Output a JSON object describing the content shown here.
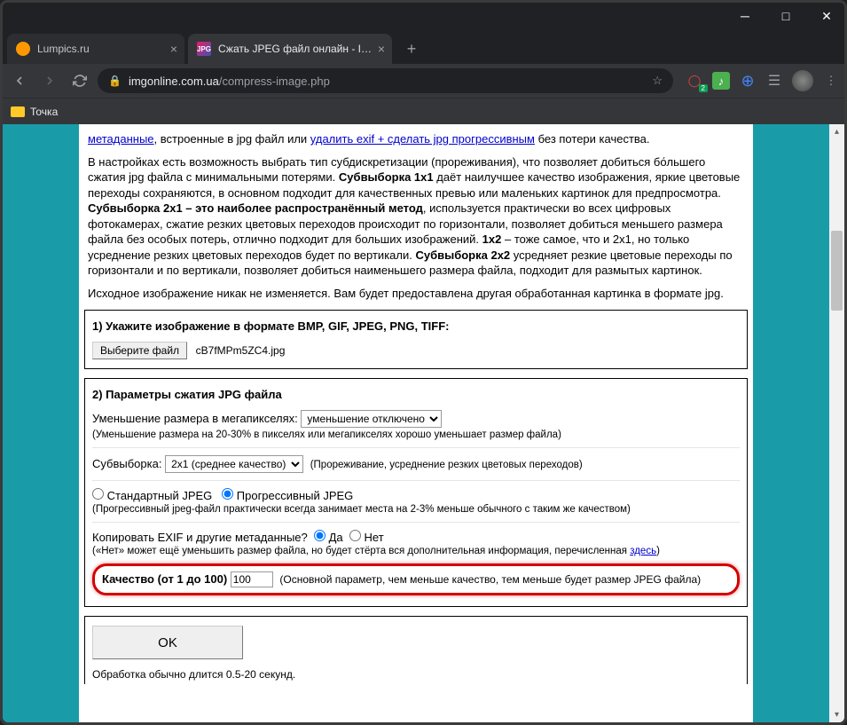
{
  "window": {
    "tabs": [
      {
        "title": "Lumpics.ru",
        "active": false
      },
      {
        "title": "Сжать JPEG файл онлайн - IMG",
        "active": true
      }
    ],
    "url_host": "imgonline.com.ua",
    "url_path": "/compress-image.php",
    "bookmark": "Точка"
  },
  "intro": {
    "line1_pre": "метаданные",
    "line1_mid": ", встроенные в jpg файл или ",
    "line1_link": "удалить exif + сделать jpg прогрессивным",
    "line1_post": " без потери качества.",
    "p2": "В настройках есть возможность выбрать тип субдискретизации (прореживания), что позволяет добиться бо́льшего сжатия jpg файла с минимальными потерями. Субвыборка 1x1 даёт наилучшее качество изображения, яркие цветовые переходы сохраняются, в основном подходит для качественных превью или маленьких картинок для предпросмотра. Субвыборка 2x1 – это наиболее распространённый метод, используется практически во всех цифровых фотокамерах, сжатие резких цветовых переходов происходит по горизонтали, позволяет добиться меньшего размера файла без особых потерь, отлично подходит для больших изображений. 1x2 – тоже самое, что и 2x1, но только усреднение резких цветовых переходов будет по вертикали. Субвыборка 2x2 усредняет резкие цветовые переходы по горизонтали и по вертикали, позволяет добиться наименьшего размера файла, подходит для размытых картинок.",
    "p3": "Исходное изображение никак не изменяется. Вам будет предоставлена другая обработанная картинка в формате jpg."
  },
  "step1": {
    "title": "1) Укажите изображение в формате BMP, GIF, JPEG, PNG, TIFF:",
    "button": "Выберите файл",
    "filename": "cB7fMPm5ZC4.jpg"
  },
  "step2": {
    "title": "2) Параметры сжатия JPG файла",
    "megapx_label": "Уменьшение размера в мегапикселях:",
    "megapx_value": "уменьшение отключено",
    "megapx_hint": "(Уменьшение размера на 20-30% в пикселях или мегапикселях хорошо уменьшает размер файла)",
    "subsample_label": "Субвыборка:",
    "subsample_value": "2x1 (среднее качество)",
    "subsample_hint": "(Прореживание, усреднение резких цветовых переходов)",
    "standard_label": "Стандартный JPEG",
    "progressive_label": "Прогрессивный JPEG",
    "progressive_hint": "(Прогрессивный jpeg-файл практически всегда занимает места на 2-3% меньше обычного с таким же качеством)",
    "exif_label": "Копировать EXIF и другие метаданные?",
    "yes": "Да",
    "no": "Нет",
    "exif_hint_pre": "(«Нет» может ещё уменьшить размер файла, но будет стёрта вся дополнительная информация, перечисленная ",
    "exif_hint_link": "здесь",
    "exif_hint_post": ")",
    "quality_label": "Качество (от 1 до 100)",
    "quality_value": "100",
    "quality_hint": "(Основной параметр, чем меньше качество, тем меньше будет размер JPEG файла)"
  },
  "step3": {
    "ok": "OK",
    "hint": "Обработка обычно длится 0.5-20 секунд."
  }
}
